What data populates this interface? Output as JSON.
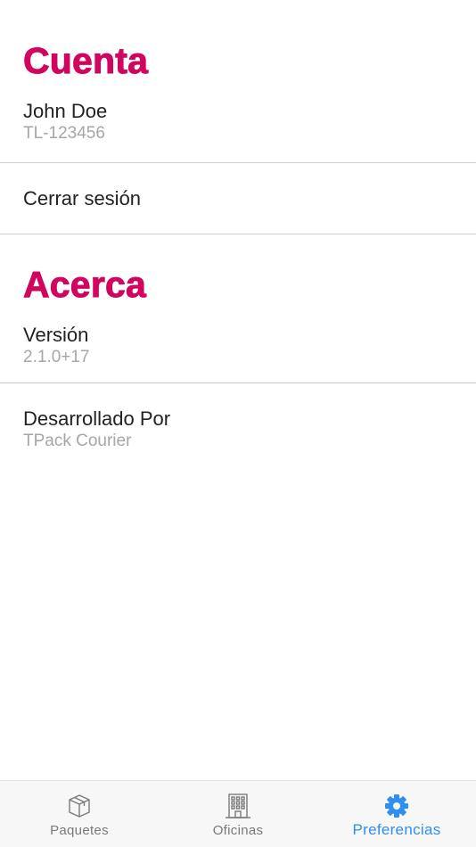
{
  "account": {
    "title": "Cuenta",
    "user_name": "John Doe",
    "user_id": "TL-123456",
    "logout_label": "Cerrar sesión"
  },
  "about": {
    "title": "Acerca",
    "version_label": "Versión",
    "version_value": "2.1.0+17",
    "developer_label": "Desarrollado Por",
    "developer_value": "TPack Courier"
  },
  "tabbar": {
    "active": "preferencias",
    "accent_color": "#2e8ff0",
    "items": [
      {
        "label": "Paquetes",
        "icon": "package-icon"
      },
      {
        "label": "Oficinas",
        "icon": "office-building-icon"
      },
      {
        "label": "Preferencias",
        "icon": "gear-icon"
      }
    ]
  },
  "colors": {
    "section_title": "#d1045e",
    "secondary_text": "#a6a6a6",
    "inactive_tab": "#7a7a7a"
  }
}
